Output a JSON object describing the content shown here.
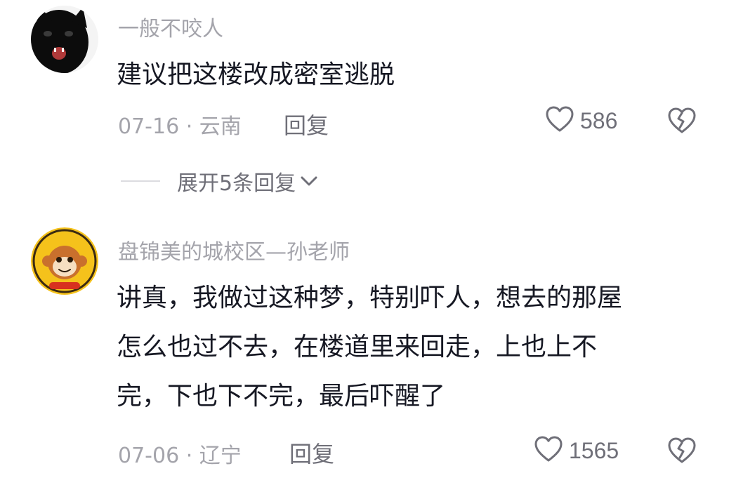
{
  "comments": [
    {
      "username": "一般不咬人",
      "avatar_icon": "black-cat-avatar-icon",
      "text_lines": [
        "建议把这楼改成密室逃脱"
      ],
      "date": "07-16",
      "location": "云南",
      "reply_label": "回复",
      "likes": "586",
      "expand_replies_label": "展开5条回复"
    },
    {
      "username": "盘锦美的城校区—孙老师",
      "avatar_icon": "monkey-logo-avatar-icon",
      "text_lines": [
        "讲真，我做过这种梦，特别吓人，想去的那屋",
        "怎么也过不去，在楼道里来回走，上也上不",
        "完，下也下不完，最后吓醒了"
      ],
      "date": "07-06",
      "location": "辽宁",
      "reply_label": "回复",
      "likes": "1565"
    }
  ],
  "meta_separator": " · ",
  "colors": {
    "text_primary": "#161823",
    "text_secondary": "#a4a4ab",
    "action_gray": "#6f6f78",
    "avatar_logo_yellow": "#f5c21b",
    "avatar_logo_orange": "#c9702d"
  }
}
